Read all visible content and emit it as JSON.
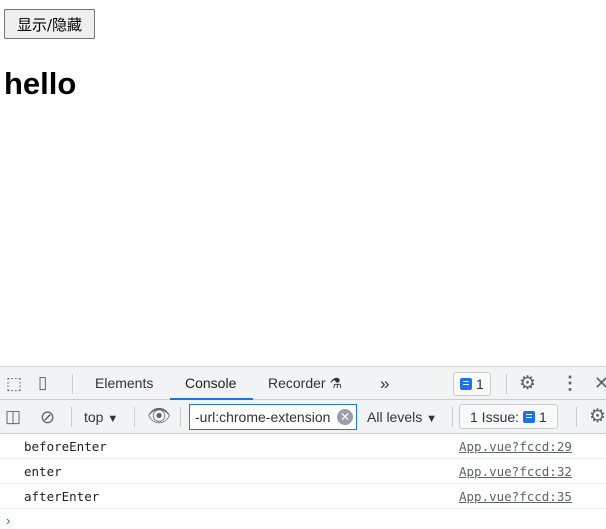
{
  "page": {
    "toggle_button": "显示/隐藏",
    "heading": "hello"
  },
  "devtools": {
    "tabs": [
      {
        "label": "Elements"
      },
      {
        "label": "Console",
        "active": true
      },
      {
        "label": "Recorder"
      }
    ],
    "more_tabs": "»",
    "issues_count": "1",
    "context": "top",
    "filter_value": "-url:chrome-extension",
    "levels": "All levels",
    "issues_label": "1 Issue:",
    "issues_badge_count": "1",
    "accent": "#1a73e8",
    "console": [
      {
        "message": "beforeEnter",
        "source": "App.vue?fccd:29"
      },
      {
        "message": "enter",
        "source": "App.vue?fccd:32"
      },
      {
        "message": "afterEnter",
        "source": "App.vue?fccd:35"
      }
    ],
    "prompt": "›"
  }
}
